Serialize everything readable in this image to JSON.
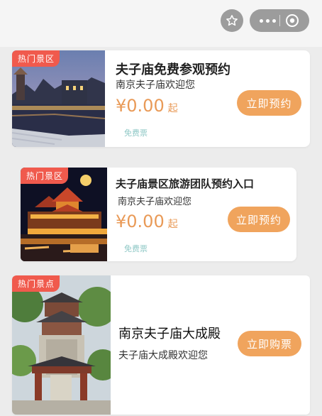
{
  "tickets": [
    {
      "tag": "热门景区",
      "title": "夫子庙免费参观预约",
      "subtitle": "南京夫子庙欢迎您",
      "price_symbol": "¥",
      "price": "0.00",
      "price_suffix": "起",
      "ticket_type": "免费票",
      "button": "立即预约"
    },
    {
      "tag": "热门景区",
      "title": "夫子庙景区旅游团队预约入口",
      "subtitle": "南京夫子庙欢迎您",
      "price_symbol": "¥",
      "price": "0.00",
      "price_suffix": "起",
      "ticket_type": "免费票",
      "button": "立即预约"
    },
    {
      "tag": "热门景点",
      "title": "南京夫子庙大成殿",
      "subtitle": "夫子庙大成殿欢迎您",
      "button": "立即购票"
    }
  ],
  "colors": {
    "tag": "#f05a4d",
    "price": "#e99a57",
    "button": "#f0a45d",
    "ticket_type": "#8fc8c6"
  },
  "icons": [
    "star-icon",
    "more-icon",
    "target-icon"
  ]
}
